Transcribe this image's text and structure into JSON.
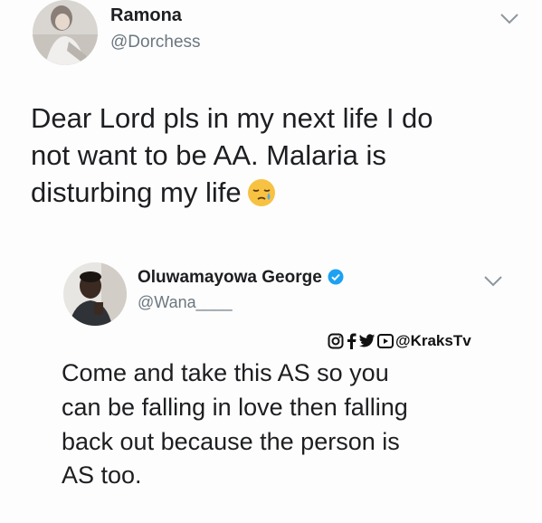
{
  "tweet": {
    "author_name": "Ramona",
    "author_handle": "@Dorchess",
    "text_lines": [
      "Dear Lord pls in my next life I do",
      "not want to be AA. Malaria is",
      "disturbing my life"
    ],
    "emoji_icon": "sleepy-face-emoji"
  },
  "reply": {
    "author_name": "Oluwamayowa George",
    "author_handle": "@Wana____",
    "verified_icon": "verified-badge-icon",
    "text_lines": [
      "Come and take this AS so you",
      "can be falling in love then falling",
      "back out because the person is",
      "AS too."
    ]
  },
  "watermark": {
    "text": "@KraksTv",
    "icons": [
      "instagram-icon",
      "facebook-icon",
      "twitter-icon",
      "youtube-icon"
    ]
  },
  "colors": {
    "text": "#1c1e21",
    "handle": "#6b7780",
    "verified": "#1da1f2"
  }
}
